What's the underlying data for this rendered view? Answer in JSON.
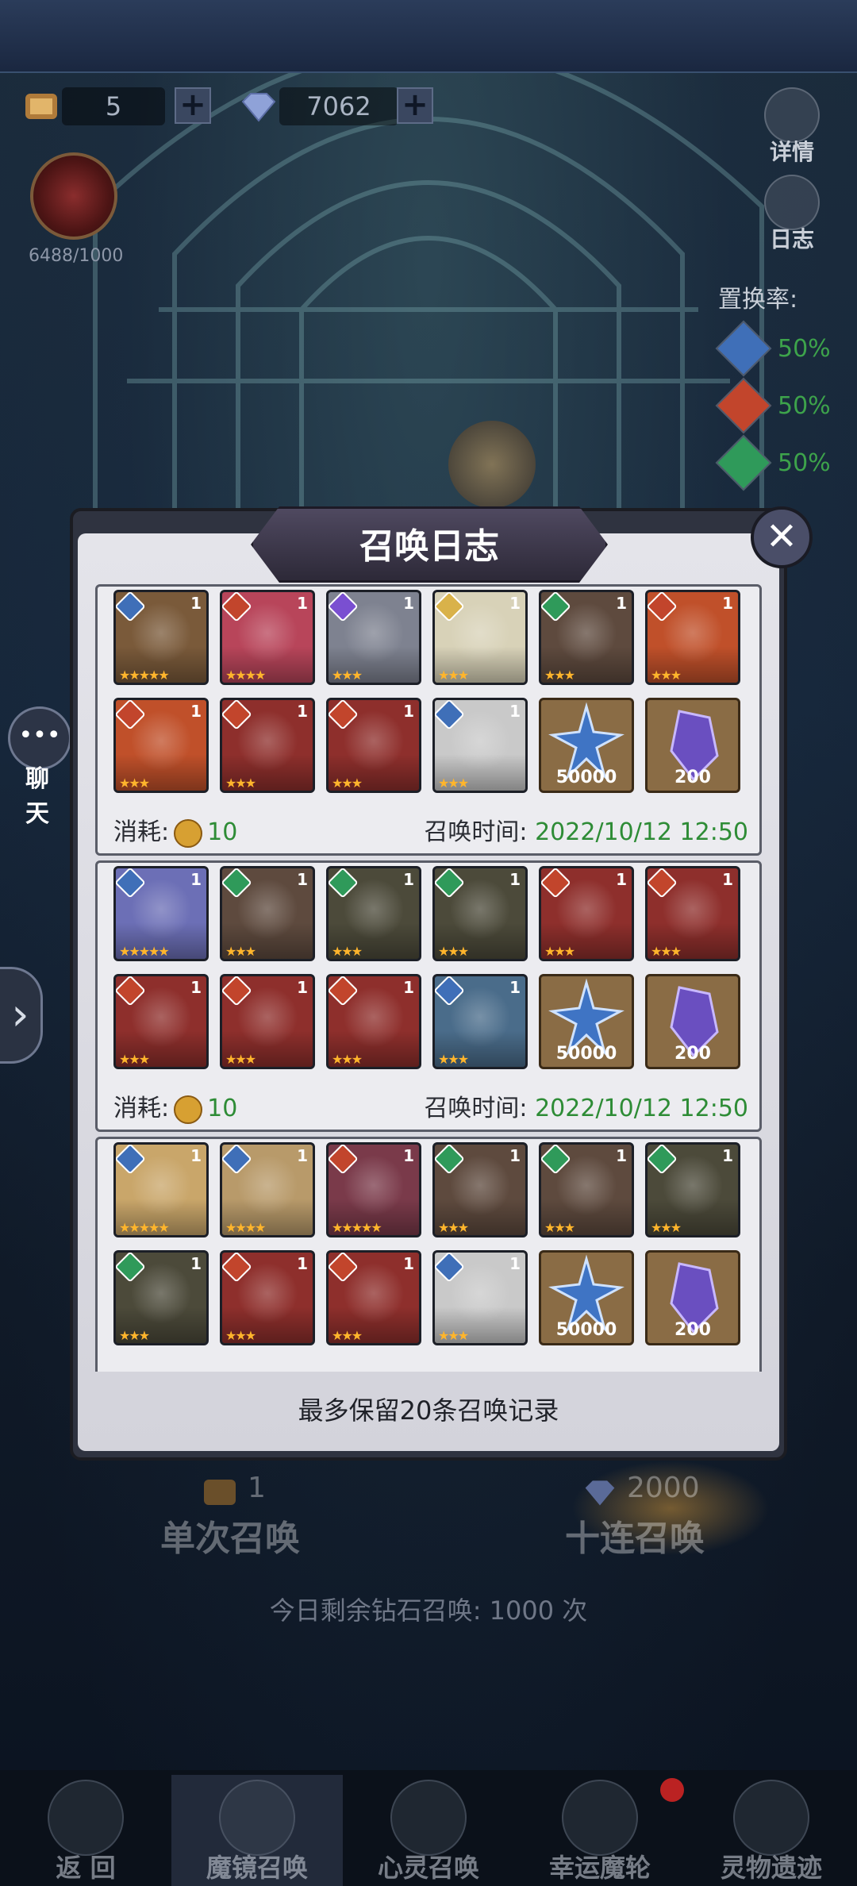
{
  "topbar": {
    "scroll_count": "5",
    "diamond_count": "7062",
    "plus_symbol": "+",
    "book_progress": "6488/1000"
  },
  "side": {
    "details_label": "详情",
    "log_label": "日志",
    "rate_title": "置换率:",
    "rates": [
      {
        "icon": "water-gem-icon",
        "value": "50%",
        "color": "#3f6fb8"
      },
      {
        "icon": "fire-gem-icon",
        "value": "50%",
        "color": "#c2452c"
      },
      {
        "icon": "nature-gem-icon",
        "value": "50%",
        "color": "#2f9a5a"
      }
    ],
    "chat_label": "聊 天",
    "chat_dots": "•••",
    "expand_arrow": "›"
  },
  "modal": {
    "title": "召唤日志",
    "close_symbol": "✕",
    "cost_label": "消耗:",
    "time_label": "召唤时间:",
    "footer_note": "最多保留20条召唤记录",
    "records": [
      {
        "cost": "10",
        "time": "2022/10/12 12:50",
        "cards": [
          {
            "elem": "#3f6fb8",
            "count": "1",
            "stars": "★★★★★",
            "tone": "#7a5a3a"
          },
          {
            "elem": "#c2452c",
            "count": "1",
            "stars": "★★★★",
            "tone": "#b8455a"
          },
          {
            "elem": "#7a4fd1",
            "count": "1",
            "stars": "★★★",
            "tone": "#7e8290"
          },
          {
            "elem": "#d9b24a",
            "count": "1",
            "stars": "★★★",
            "tone": "#d8d2b8"
          },
          {
            "elem": "#2f9a5a",
            "count": "1",
            "stars": "★★★",
            "tone": "#5e4a3e"
          },
          {
            "elem": "#c2452c",
            "count": "1",
            "stars": "★★★",
            "tone": "#c0502a"
          },
          {
            "elem": "#c2452c",
            "count": "1",
            "stars": "★★★",
            "tone": "#c0502a"
          },
          {
            "elem": "#c2452c",
            "count": "1",
            "stars": "★★★",
            "tone": "#8e2f2c"
          },
          {
            "elem": "#c2452c",
            "count": "1",
            "stars": "★★★",
            "tone": "#8e2f2c"
          },
          {
            "elem": "#3f6fb8",
            "count": "1",
            "stars": "★★★",
            "tone": "#c9c9c9"
          }
        ],
        "items": [
          {
            "icon": "exp-icon",
            "qty": "50000"
          },
          {
            "icon": "crystal-icon",
            "qty": "200"
          }
        ]
      },
      {
        "cost": "10",
        "time": "2022/10/12 12:50",
        "cards": [
          {
            "elem": "#3f6fb8",
            "count": "1",
            "stars": "★★★★★",
            "tone": "#6c6fb6"
          },
          {
            "elem": "#2f9a5a",
            "count": "1",
            "stars": "★★★",
            "tone": "#5e4a3e"
          },
          {
            "elem": "#2f9a5a",
            "count": "1",
            "stars": "★★★",
            "tone": "#4c4a3a"
          },
          {
            "elem": "#2f9a5a",
            "count": "1",
            "stars": "★★★",
            "tone": "#4c4a3a"
          },
          {
            "elem": "#c2452c",
            "count": "1",
            "stars": "★★★",
            "tone": "#8e2f2c"
          },
          {
            "elem": "#c2452c",
            "count": "1",
            "stars": "★★★",
            "tone": "#8e2f2c"
          },
          {
            "elem": "#c2452c",
            "count": "1",
            "stars": "★★★",
            "tone": "#8e2f2c"
          },
          {
            "elem": "#c2452c",
            "count": "1",
            "stars": "★★★",
            "tone": "#8e2f2c"
          },
          {
            "elem": "#c2452c",
            "count": "1",
            "stars": "★★★",
            "tone": "#8e2f2c"
          },
          {
            "elem": "#3f6fb8",
            "count": "1",
            "stars": "★★★",
            "tone": "#4a6c8a"
          }
        ],
        "items": [
          {
            "icon": "exp-icon",
            "qty": "50000"
          },
          {
            "icon": "crystal-icon",
            "qty": "200"
          }
        ]
      },
      {
        "cost": "",
        "time": "",
        "cards": [
          {
            "elem": "#3f6fb8",
            "count": "1",
            "stars": "★★★★★",
            "tone": "#c9a66a"
          },
          {
            "elem": "#3f6fb8",
            "count": "1",
            "stars": "★★★★",
            "tone": "#b89a6a"
          },
          {
            "elem": "#c2452c",
            "count": "1",
            "stars": "★★★★★",
            "tone": "#7a3a4a"
          },
          {
            "elem": "#2f9a5a",
            "count": "1",
            "stars": "★★★",
            "tone": "#5e4a3e"
          },
          {
            "elem": "#2f9a5a",
            "count": "1",
            "stars": "★★★",
            "tone": "#5e4a3e"
          },
          {
            "elem": "#2f9a5a",
            "count": "1",
            "stars": "★★★",
            "tone": "#4c4a3a"
          },
          {
            "elem": "#2f9a5a",
            "count": "1",
            "stars": "★★★",
            "tone": "#4c4a3a"
          },
          {
            "elem": "#c2452c",
            "count": "1",
            "stars": "★★★",
            "tone": "#8e2f2c"
          },
          {
            "elem": "#c2452c",
            "count": "1",
            "stars": "★★★",
            "tone": "#8e2f2c"
          },
          {
            "elem": "#3f6fb8",
            "count": "1",
            "stars": "★★★",
            "tone": "#c9c9c9"
          }
        ],
        "items": [
          {
            "icon": "exp-icon",
            "qty": "50000"
          },
          {
            "icon": "crystal-icon",
            "qty": "200"
          }
        ]
      }
    ]
  },
  "summon": {
    "single_cost": "1",
    "single_label": "单次召唤",
    "ten_cost": "2000",
    "ten_label": "十连召唤",
    "remaining": "今日剩余钻石召唤: 1000 次"
  },
  "nav": [
    {
      "label": "返 回",
      "icon": "back-icon"
    },
    {
      "label": "魔镜召唤",
      "icon": "mirror-icon"
    },
    {
      "label": "心灵召唤",
      "icon": "soul-icon"
    },
    {
      "label": "幸运魔轮",
      "icon": "wheel-icon"
    },
    {
      "label": "灵物遗迹",
      "icon": "relic-icon"
    }
  ]
}
